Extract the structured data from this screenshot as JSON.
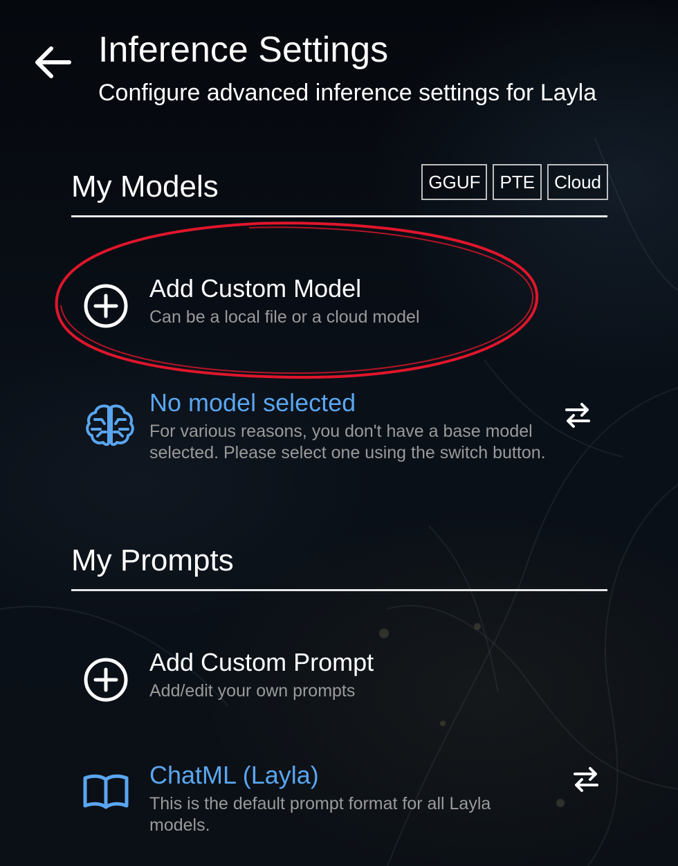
{
  "header": {
    "title": "Inference Settings",
    "subtitle": "Configure advanced inference settings for Layla",
    "back_icon": "arrow-left-icon"
  },
  "models_section": {
    "title": "My Models",
    "format_tags": [
      "GGUF",
      "PTE",
      "Cloud"
    ],
    "add_custom": {
      "title": "Add Custom Model",
      "description": "Can be a local file or a cloud model",
      "icon": "plus-circle-icon"
    },
    "selected": {
      "title": "No model selected",
      "description": "For various reasons, you don't have a base model selected. Please select one using the switch button.",
      "icon": "brain-icon",
      "action_icon": "swap-arrows-icon"
    }
  },
  "prompts_section": {
    "title": "My Prompts",
    "add_custom": {
      "title": "Add Custom Prompt",
      "description": "Add/edit your own prompts",
      "icon": "plus-circle-icon"
    },
    "selected": {
      "title": "ChatML (Layla)",
      "description": "This is the default prompt format for all Layla models.",
      "icon": "book-icon",
      "action_icon": "swap-arrows-icon"
    }
  },
  "colors": {
    "accent_blue": "#5aa6f0",
    "highlight_red": "#e0162b",
    "muted_text": "#9a9a9a"
  }
}
